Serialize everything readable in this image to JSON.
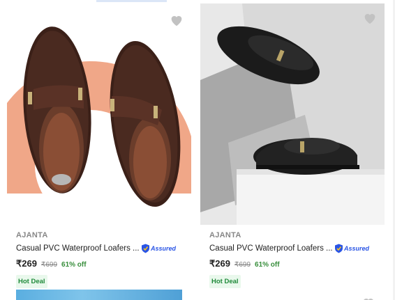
{
  "products": [
    {
      "brand": "AJANTA",
      "title": "Casual PVC Waterproof Loafers ...",
      "assured_label": "Assured",
      "price": "₹269",
      "mrp": "₹699",
      "discount": "61% off",
      "badge": "Hot Deal",
      "image_icon": "brown-loafers-on-peach-circle",
      "wishlist_icon": "heart-icon"
    },
    {
      "brand": "AJANTA",
      "title": "Casual PVC Waterproof Loafers ...",
      "assured_label": "Assured",
      "price": "₹269",
      "mrp": "₹699",
      "discount": "61% off",
      "badge": "Hot Deal",
      "image_icon": "black-loafers-on-grey-blocks",
      "wishlist_icon": "heart-icon"
    }
  ],
  "colors": {
    "brand_text": "#878787",
    "price_text": "#212121",
    "discount_green": "#388e3c",
    "assured_blue": "#2a55e5",
    "deal_bg": "#e9f8ec",
    "wishlist_grey": "#c2c2c2"
  }
}
